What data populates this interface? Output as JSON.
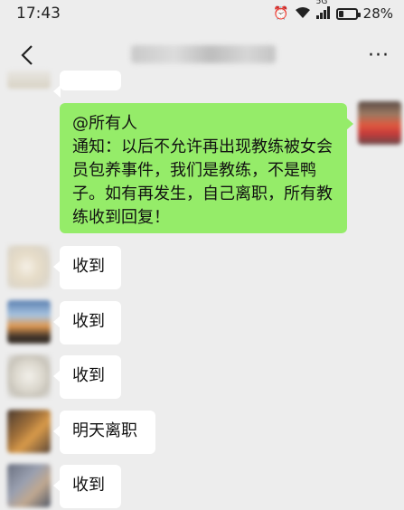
{
  "status_bar": {
    "time": "17:43",
    "network": "5G",
    "battery_percent": "28%",
    "battery_level": 0.28
  },
  "header": {
    "back_icon": "chevron-left-icon",
    "more_label": "···"
  },
  "messages": {
    "announcement": "@所有人\n通知：以后不允许再出现教练被女会员包养事件，我们是教练，不是鸭子。如有再发生，自己离职，所有教练收到回复！",
    "reply_1": "收到",
    "reply_2": "收到",
    "reply_3": "收到",
    "reply_4": "明天离职",
    "reply_5": "收到"
  },
  "colors": {
    "background": "#ededed",
    "self_bubble": "#95ec69",
    "other_bubble": "#ffffff"
  }
}
